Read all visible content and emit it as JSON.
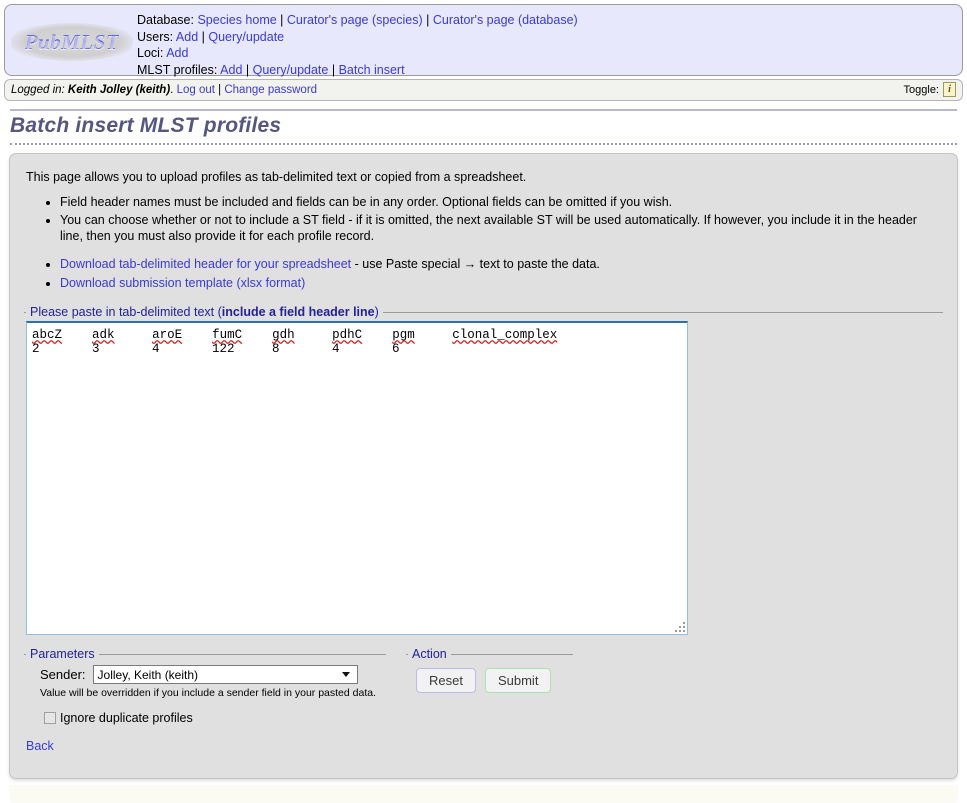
{
  "header": {
    "logo_text": "PubMLST",
    "nav": [
      {
        "label": "Database:",
        "links": [
          {
            "text": "Species home"
          },
          {
            "text": "Curator's page (species)"
          },
          {
            "text": "Curator's page (database)"
          }
        ]
      },
      {
        "label": "Users:",
        "links": [
          {
            "text": "Add"
          },
          {
            "text": "Query/update"
          }
        ]
      },
      {
        "label": "Loci:",
        "links": [
          {
            "text": "Add"
          }
        ]
      },
      {
        "label": "MLST profiles:",
        "links": [
          {
            "text": "Add"
          },
          {
            "text": "Query/update"
          },
          {
            "text": "Batch insert"
          }
        ]
      }
    ]
  },
  "login_bar": {
    "prefix": "Logged in:",
    "user": "Keith Jolley (keith)",
    "period": ".",
    "logout_label": "Log out",
    "separator": "|",
    "change_password_label": "Change password",
    "toggle_label": "Toggle:",
    "toggle_icon_glyph": "i"
  },
  "page": {
    "title": "Batch insert MLST profiles",
    "intro": "This page allows you to upload profiles as tab-delimited text or copied from a spreadsheet.",
    "bullets": [
      "Field header names must be included and fields can be in any order. Optional fields can be omitted if you wish.",
      "You can choose whether or not to include a ST field - if it is omitted, the next available ST will be used automatically. If however, you include it in the header line, then you must also provide it for each profile record."
    ],
    "download_links": {
      "header_link": "Download tab-delimited header for your spreadsheet",
      "header_suffix": " - use Paste special → text to paste the data.",
      "template_link": "Download submission template (xlsx format)"
    },
    "back_label": "Back"
  },
  "paste_fieldset": {
    "legend_plain": "Please paste in tab-delimited text (",
    "legend_bold": "include a field header line",
    "legend_close": ")",
    "columns": [
      "abcZ",
      "adk",
      "aroE",
      "fumC",
      "gdh",
      "pdhC",
      "pgm",
      "clonal_complex"
    ],
    "values": [
      "2",
      "3",
      "4",
      "122",
      "8",
      "4",
      "6",
      ""
    ]
  },
  "parameters": {
    "legend": "Parameters",
    "sender_label": "Sender:",
    "sender_value": "Jolley, Keith (keith)",
    "sender_note": "Value will be overridden if you include a sender field in your pasted data.",
    "ignore_duplicates_label": "Ignore duplicate profiles",
    "ignore_duplicates_checked": false
  },
  "action": {
    "legend": "Action",
    "reset_label": "Reset",
    "submit_label": "Submit"
  },
  "colors": {
    "link": "#3a3ad4",
    "nav_bg": "#e8e8fc",
    "panel_bg": "#e0e0e0",
    "title": "#56567f",
    "legend": "#222299",
    "reset_border": "#bcbce8",
    "submit_border": "#aee0ae",
    "textarea_border_top": "#2f6fa8",
    "spell_underline": "#d42020"
  }
}
